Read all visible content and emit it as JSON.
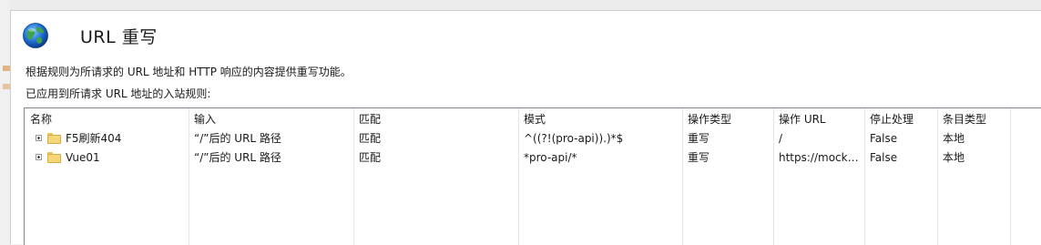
{
  "header": {
    "title": "URL 重写"
  },
  "description": "根据规则为所请求的 URL 地址和 HTTP 响应的内容提供重写功能。",
  "subtitle": "已应用到所请求 URL 地址的入站规则:",
  "table": {
    "columns": [
      "名称",
      "输入",
      "匹配",
      "模式",
      "操作类型",
      "操作 URL",
      "停止处理",
      "条目类型"
    ],
    "rows": [
      {
        "name": "F5刷新404",
        "input": "“/”后的 URL 路径",
        "match": "匹配",
        "pattern": "^((?!(pro-api)).)*$",
        "action_type": "重写",
        "action_url": "/",
        "stop": "False",
        "entry_type": "本地"
      },
      {
        "name": "Vue01",
        "input": "“/”后的 URL 路径",
        "match": "匹配",
        "pattern": "*pro-api/*",
        "action_type": "重写",
        "action_url": "https://mock....",
        "stop": "False",
        "entry_type": "本地"
      }
    ]
  },
  "icons": {
    "header": "globe-icon",
    "row": "folder-icon"
  }
}
